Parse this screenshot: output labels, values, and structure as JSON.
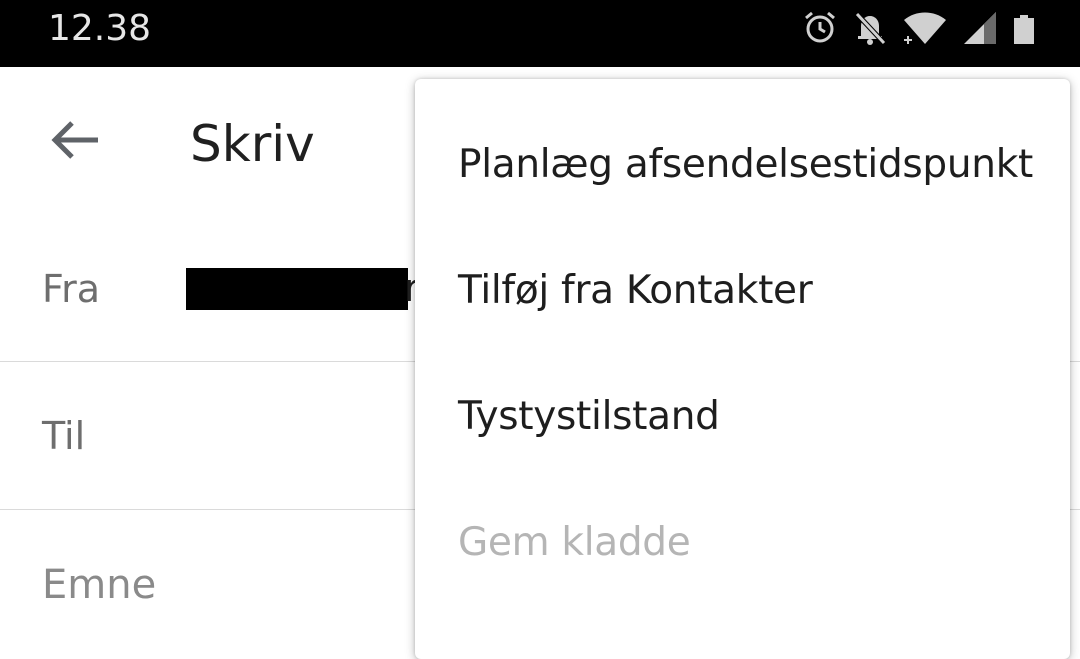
{
  "status_bar": {
    "time": "12.38",
    "icons": [
      "alarm-icon",
      "notifications-off-icon",
      "wifi-icon",
      "signal-icon",
      "battery-icon"
    ]
  },
  "app_bar": {
    "back_icon": "arrow-back-icon",
    "title": "Skriv"
  },
  "fields": {
    "from_label": "Fra",
    "from_value_visible_tail": "r",
    "to_label": "Til",
    "subject_label": "Emne"
  },
  "menu": {
    "items": [
      {
        "label": "Planlæg afsendelsestidspunkt",
        "enabled": true
      },
      {
        "label": "Tilføj fra Kontakter",
        "enabled": true
      },
      {
        "label": "Tystystilstand",
        "enabled": true
      },
      {
        "label": "Gem kladde",
        "enabled": false
      }
    ]
  },
  "colors": {
    "status_bar_bg": "#000000",
    "text_primary": "#202020",
    "text_secondary": "#6e6e6e",
    "text_disabled": "#b5b5b5",
    "divider": "#dadada"
  }
}
